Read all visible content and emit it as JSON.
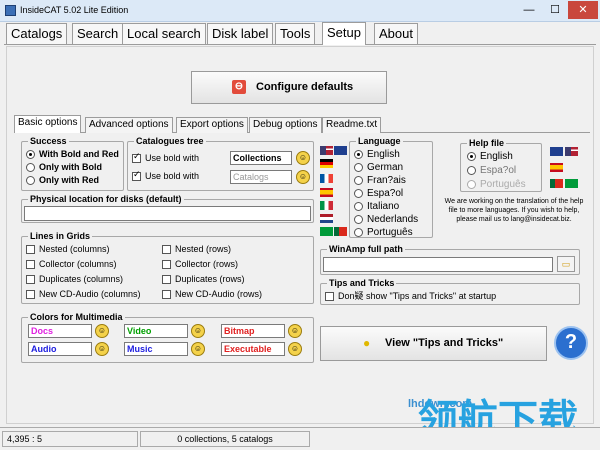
{
  "window": {
    "title": "InsideCAT 5.02 Lite Edition",
    "minimize": "—",
    "maximize": "☐",
    "close": "✕"
  },
  "menu_tabs": [
    "Catalogs",
    "Search",
    "Local search",
    "Disk label",
    "Tools",
    "Setup",
    "About"
  ],
  "configure_button": "Configure defaults",
  "sub_tabs": [
    "Basic options",
    "Advanced options",
    "Export options",
    "Debug options",
    "Readme.txt"
  ],
  "success": {
    "title": "Success",
    "options": [
      "With Bold and Red",
      "Only with Bold",
      "Only with Red"
    ]
  },
  "catalogues_tree": {
    "title": "Catalogues tree",
    "rows": [
      {
        "label": "Use bold with",
        "value": "Collections"
      },
      {
        "label": "Use bold with",
        "value": "Catalogs"
      }
    ]
  },
  "physical": {
    "title": "Physical location for disks (default)",
    "value": ""
  },
  "lines_in_grids": {
    "title": "Lines in Grids",
    "left": [
      "Nested (columns)",
      "Collector (columns)",
      "Duplicates (columns)",
      "New CD-Audio (columns)"
    ],
    "right": [
      "Nested (rows)",
      "Collector (rows)",
      "Duplicates (rows)",
      "New CD-Audio (rows)"
    ]
  },
  "colors": {
    "title": "Colors for Multimedia",
    "items": [
      "Docs",
      "Video",
      "Bitmap",
      "Audio",
      "Music",
      "Executable"
    ],
    "item_colors": [
      "#e020e0",
      "#00a000",
      "#e02020",
      "#2020e0",
      "#2020e0",
      "#e02020"
    ]
  },
  "language": {
    "title": "Language",
    "options": [
      "English",
      "German",
      "Fran?ais",
      "Espa?ol",
      "Italiano",
      "Nederlands",
      "Português"
    ]
  },
  "help_file": {
    "title": "Help file",
    "options": [
      "English",
      "Espa?ol",
      "Português"
    ]
  },
  "translation_note": "We are working on the translation of the help file to more languages. If you wish to help, please mail us to lang@insidecat.biz.",
  "winamp": {
    "title": "WinAmp full path",
    "value": ""
  },
  "tips": {
    "title": "Tips and Tricks",
    "checkbox": "Don疑 show \"Tips and Tricks\" at startup",
    "view_button": "View \"Tips and Tricks\""
  },
  "help_button": "?",
  "status": {
    "left": "4,395 : 5",
    "middle": "0 collections, 5 catalogs"
  },
  "watermark": {
    "site": "lhdown.com",
    "text": "领航下载"
  },
  "icons": {
    "configure": "cancel-icon",
    "folder": "folder-icon",
    "bulb": "bulb-icon",
    "help": "help-icon",
    "app": "app-icon"
  }
}
